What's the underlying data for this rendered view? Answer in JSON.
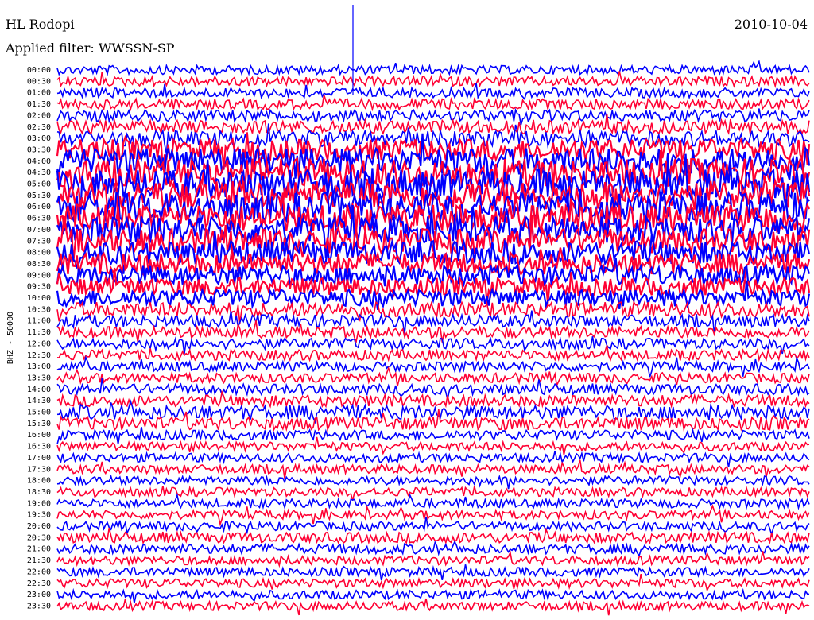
{
  "header": {
    "station": "HL Rodopi",
    "filter": "Applied filter: WWSSN-SP",
    "date": "2010-10-04"
  },
  "chart_data": {
    "type": "line",
    "title": "HL Rodopi",
    "subtitle": "Applied filter: WWSSN-SP",
    "ylabel": "BHZ - 50000",
    "row_labels": [
      "00:00",
      "00:30",
      "01:00",
      "01:30",
      "02:00",
      "02:30",
      "03:00",
      "03:30",
      "04:00",
      "04:30",
      "05:00",
      "05:30",
      "06:00",
      "06:30",
      "07:00",
      "07:30",
      "08:00",
      "08:30",
      "09:00",
      "09:30",
      "10:00",
      "10:30",
      "11:00",
      "11:30",
      "12:00",
      "12:30",
      "13:00",
      "13:30",
      "14:00",
      "14:30",
      "15:00",
      "15:30",
      "16:00",
      "16:30",
      "17:00",
      "17:30",
      "18:00",
      "18:30",
      "19:00",
      "19:30",
      "20:00",
      "20:30",
      "21:00",
      "21:30",
      "22:00",
      "22:30",
      "23:00",
      "23:30"
    ],
    "series_colors": [
      "#0000ff",
      "#ff0033"
    ],
    "row_activity": [
      1.0,
      1.1,
      1.1,
      1.2,
      1.3,
      1.5,
      1.8,
      2.4,
      3.0,
      3.2,
      3.3,
      3.3,
      3.2,
      3.1,
      3.0,
      2.8,
      2.6,
      2.4,
      2.2,
      2.0,
      1.9,
      1.7,
      1.4,
      1.3,
      1.2,
      1.2,
      1.1,
      1.1,
      1.2,
      1.3,
      1.6,
      1.5,
      1.1,
      1.0,
      1.0,
      1.0,
      1.0,
      1.0,
      1.0,
      1.0,
      1.0,
      1.2,
      1.1,
      1.0,
      1.0,
      1.0,
      1.0,
      1.0
    ],
    "grid": false,
    "legend": "none"
  }
}
